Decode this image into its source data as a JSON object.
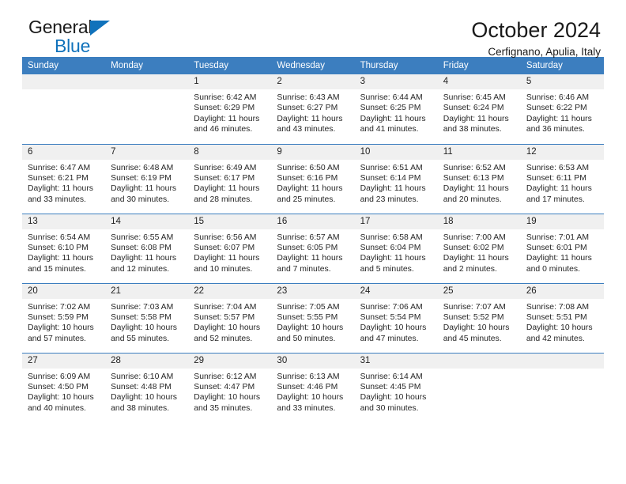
{
  "brand": {
    "name_top": "General",
    "name_bottom": "Blue",
    "accent_color": "#1072bb"
  },
  "header": {
    "title": "October 2024",
    "location": "Cerfignano, Apulia, Italy"
  },
  "calendar": {
    "header_bg": "#3c7ebf",
    "daynum_bg": "#f0f0f0",
    "weekday_labels": [
      "Sunday",
      "Monday",
      "Tuesday",
      "Wednesday",
      "Thursday",
      "Friday",
      "Saturday"
    ],
    "labels": {
      "sunrise_prefix": "Sunrise:",
      "sunset_prefix": "Sunset:",
      "daylight_prefix": "Daylight:"
    },
    "weeks": [
      [
        {
          "day": "",
          "empty": true
        },
        {
          "day": "",
          "empty": true
        },
        {
          "day": "1",
          "sunrise": "Sunrise: 6:42 AM",
          "sunset": "Sunset: 6:29 PM",
          "daylight_line1": "Daylight: 11 hours",
          "daylight_line2": "and 46 minutes."
        },
        {
          "day": "2",
          "sunrise": "Sunrise: 6:43 AM",
          "sunset": "Sunset: 6:27 PM",
          "daylight_line1": "Daylight: 11 hours",
          "daylight_line2": "and 43 minutes."
        },
        {
          "day": "3",
          "sunrise": "Sunrise: 6:44 AM",
          "sunset": "Sunset: 6:25 PM",
          "daylight_line1": "Daylight: 11 hours",
          "daylight_line2": "and 41 minutes."
        },
        {
          "day": "4",
          "sunrise": "Sunrise: 6:45 AM",
          "sunset": "Sunset: 6:24 PM",
          "daylight_line1": "Daylight: 11 hours",
          "daylight_line2": "and 38 minutes."
        },
        {
          "day": "5",
          "sunrise": "Sunrise: 6:46 AM",
          "sunset": "Sunset: 6:22 PM",
          "daylight_line1": "Daylight: 11 hours",
          "daylight_line2": "and 36 minutes."
        }
      ],
      [
        {
          "day": "6",
          "sunrise": "Sunrise: 6:47 AM",
          "sunset": "Sunset: 6:21 PM",
          "daylight_line1": "Daylight: 11 hours",
          "daylight_line2": "and 33 minutes."
        },
        {
          "day": "7",
          "sunrise": "Sunrise: 6:48 AM",
          "sunset": "Sunset: 6:19 PM",
          "daylight_line1": "Daylight: 11 hours",
          "daylight_line2": "and 30 minutes."
        },
        {
          "day": "8",
          "sunrise": "Sunrise: 6:49 AM",
          "sunset": "Sunset: 6:17 PM",
          "daylight_line1": "Daylight: 11 hours",
          "daylight_line2": "and 28 minutes."
        },
        {
          "day": "9",
          "sunrise": "Sunrise: 6:50 AM",
          "sunset": "Sunset: 6:16 PM",
          "daylight_line1": "Daylight: 11 hours",
          "daylight_line2": "and 25 minutes."
        },
        {
          "day": "10",
          "sunrise": "Sunrise: 6:51 AM",
          "sunset": "Sunset: 6:14 PM",
          "daylight_line1": "Daylight: 11 hours",
          "daylight_line2": "and 23 minutes."
        },
        {
          "day": "11",
          "sunrise": "Sunrise: 6:52 AM",
          "sunset": "Sunset: 6:13 PM",
          "daylight_line1": "Daylight: 11 hours",
          "daylight_line2": "and 20 minutes."
        },
        {
          "day": "12",
          "sunrise": "Sunrise: 6:53 AM",
          "sunset": "Sunset: 6:11 PM",
          "daylight_line1": "Daylight: 11 hours",
          "daylight_line2": "and 17 minutes."
        }
      ],
      [
        {
          "day": "13",
          "sunrise": "Sunrise: 6:54 AM",
          "sunset": "Sunset: 6:10 PM",
          "daylight_line1": "Daylight: 11 hours",
          "daylight_line2": "and 15 minutes."
        },
        {
          "day": "14",
          "sunrise": "Sunrise: 6:55 AM",
          "sunset": "Sunset: 6:08 PM",
          "daylight_line1": "Daylight: 11 hours",
          "daylight_line2": "and 12 minutes."
        },
        {
          "day": "15",
          "sunrise": "Sunrise: 6:56 AM",
          "sunset": "Sunset: 6:07 PM",
          "daylight_line1": "Daylight: 11 hours",
          "daylight_line2": "and 10 minutes."
        },
        {
          "day": "16",
          "sunrise": "Sunrise: 6:57 AM",
          "sunset": "Sunset: 6:05 PM",
          "daylight_line1": "Daylight: 11 hours",
          "daylight_line2": "and 7 minutes."
        },
        {
          "day": "17",
          "sunrise": "Sunrise: 6:58 AM",
          "sunset": "Sunset: 6:04 PM",
          "daylight_line1": "Daylight: 11 hours",
          "daylight_line2": "and 5 minutes."
        },
        {
          "day": "18",
          "sunrise": "Sunrise: 7:00 AM",
          "sunset": "Sunset: 6:02 PM",
          "daylight_line1": "Daylight: 11 hours",
          "daylight_line2": "and 2 minutes."
        },
        {
          "day": "19",
          "sunrise": "Sunrise: 7:01 AM",
          "sunset": "Sunset: 6:01 PM",
          "daylight_line1": "Daylight: 11 hours",
          "daylight_line2": "and 0 minutes."
        }
      ],
      [
        {
          "day": "20",
          "sunrise": "Sunrise: 7:02 AM",
          "sunset": "Sunset: 5:59 PM",
          "daylight_line1": "Daylight: 10 hours",
          "daylight_line2": "and 57 minutes."
        },
        {
          "day": "21",
          "sunrise": "Sunrise: 7:03 AM",
          "sunset": "Sunset: 5:58 PM",
          "daylight_line1": "Daylight: 10 hours",
          "daylight_line2": "and 55 minutes."
        },
        {
          "day": "22",
          "sunrise": "Sunrise: 7:04 AM",
          "sunset": "Sunset: 5:57 PM",
          "daylight_line1": "Daylight: 10 hours",
          "daylight_line2": "and 52 minutes."
        },
        {
          "day": "23",
          "sunrise": "Sunrise: 7:05 AM",
          "sunset": "Sunset: 5:55 PM",
          "daylight_line1": "Daylight: 10 hours",
          "daylight_line2": "and 50 minutes."
        },
        {
          "day": "24",
          "sunrise": "Sunrise: 7:06 AM",
          "sunset": "Sunset: 5:54 PM",
          "daylight_line1": "Daylight: 10 hours",
          "daylight_line2": "and 47 minutes."
        },
        {
          "day": "25",
          "sunrise": "Sunrise: 7:07 AM",
          "sunset": "Sunset: 5:52 PM",
          "daylight_line1": "Daylight: 10 hours",
          "daylight_line2": "and 45 minutes."
        },
        {
          "day": "26",
          "sunrise": "Sunrise: 7:08 AM",
          "sunset": "Sunset: 5:51 PM",
          "daylight_line1": "Daylight: 10 hours",
          "daylight_line2": "and 42 minutes."
        }
      ],
      [
        {
          "day": "27",
          "sunrise": "Sunrise: 6:09 AM",
          "sunset": "Sunset: 4:50 PM",
          "daylight_line1": "Daylight: 10 hours",
          "daylight_line2": "and 40 minutes."
        },
        {
          "day": "28",
          "sunrise": "Sunrise: 6:10 AM",
          "sunset": "Sunset: 4:48 PM",
          "daylight_line1": "Daylight: 10 hours",
          "daylight_line2": "and 38 minutes."
        },
        {
          "day": "29",
          "sunrise": "Sunrise: 6:12 AM",
          "sunset": "Sunset: 4:47 PM",
          "daylight_line1": "Daylight: 10 hours",
          "daylight_line2": "and 35 minutes."
        },
        {
          "day": "30",
          "sunrise": "Sunrise: 6:13 AM",
          "sunset": "Sunset: 4:46 PM",
          "daylight_line1": "Daylight: 10 hours",
          "daylight_line2": "and 33 minutes."
        },
        {
          "day": "31",
          "sunrise": "Sunrise: 6:14 AM",
          "sunset": "Sunset: 4:45 PM",
          "daylight_line1": "Daylight: 10 hours",
          "daylight_line2": "and 30 minutes."
        },
        {
          "day": "",
          "empty": true
        },
        {
          "day": "",
          "empty": true
        }
      ]
    ]
  }
}
